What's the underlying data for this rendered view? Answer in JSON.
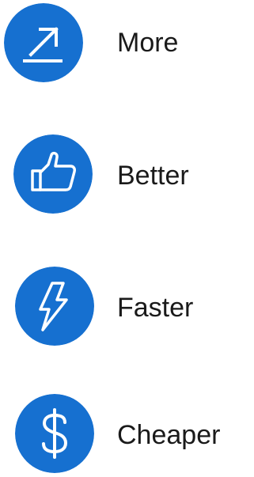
{
  "accent_color": "#1670d0",
  "icon_stroke_color": "#ffffff",
  "items": [
    {
      "label": "More",
      "icon": "arrow-up-right-icon"
    },
    {
      "label": "Better",
      "icon": "thumbs-up-icon"
    },
    {
      "label": "Faster",
      "icon": "lightning-bolt-icon"
    },
    {
      "label": "Cheaper",
      "icon": "dollar-sign-icon"
    }
  ]
}
